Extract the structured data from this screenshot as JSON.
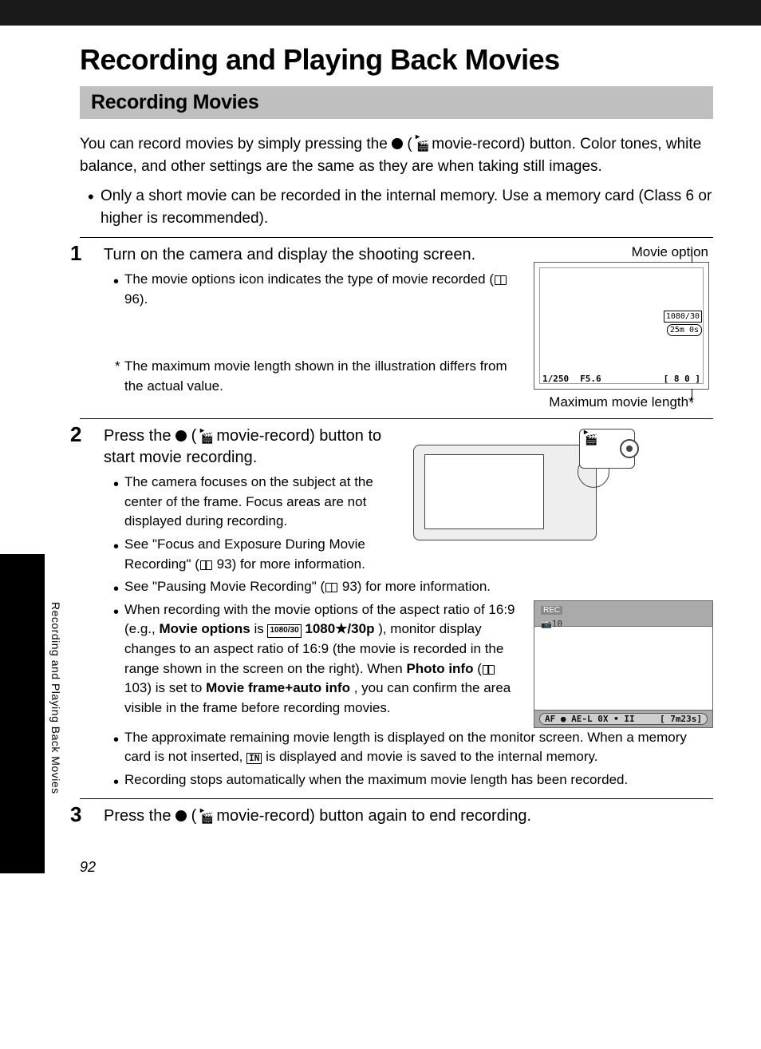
{
  "sideCaption": "Recording and Playing Back Movies",
  "pageNumber": "92",
  "title": "Recording and Playing Back Movies",
  "sectionTitle": "Recording Movies",
  "intro": {
    "p1_a": "You can record movies by simply pressing the ",
    "p1_b": " ( ",
    "p1_c": " movie-record) button. Color tones, white balance, and other settings are the same as they are when taking still images.",
    "bullet1": "Only a short movie can be recorded in the internal memory. Use a memory card (Class 6 or higher is recommended)."
  },
  "step1": {
    "head": "Turn on the camera and display the shooting screen.",
    "b1_a": "The movie options icon indicates the type of movie recorded (",
    "b1_ref": "96",
    "b1_b": ").",
    "note": "The maximum movie length shown in the illustration differs from the actual value.",
    "capTop": "Movie option",
    "capBottom": "Maximum movie length*",
    "fig": {
      "shutter": "1/250",
      "fnum": "F5.6",
      "count": "[  8 0 ]",
      "res": "1080/30",
      "time": "25m 0s"
    }
  },
  "step2": {
    "head_a": "Press the ",
    "head_b": " ( ",
    "head_c": " movie-record) button to start movie recording.",
    "b1": "The camera focuses on the subject at the center of the frame. Focus areas are not displayed during recording.",
    "b2_a": "See \"Focus and Exposure During Movie Recording\" (",
    "b2_ref": "93",
    "b2_b": ") for more information.",
    "b3_a": "See \"Pausing Movie Recording\" (",
    "b3_ref": "93",
    "b3_b": ") for more information.",
    "b4_a": "When recording with the movie options of the aspect ratio of 16:9 (e.g., ",
    "b4_mo": "Movie options",
    "b4_b": " is ",
    "b4_opt": "1080★/30p",
    "b4_c": "), monitor display changes to an aspect ratio of 16:9 (the movie is recorded in the range shown in the screen on the right). When ",
    "b4_pi": "Photo info",
    "b4_d": " (",
    "b4_ref": "103",
    "b4_e": ") is set to ",
    "b4_mf": "Movie frame+auto info",
    "b4_f": ", you can confirm the area visible in the frame before recording movies.",
    "b5_a": "The approximate remaining movie length is displayed on the monitor screen. When a memory card is not inserted, ",
    "b5_b": " is displayed and movie is saved to the internal memory.",
    "b6": "Recording stops automatically when the maximum movie length has been recorded.",
    "rec": {
      "label": "REC",
      "sub": "10",
      "left": "AF ● AE-L  0X • II",
      "right": "[  7m23s]"
    }
  },
  "step3": {
    "head_a": "Press the ",
    "head_b": " ( ",
    "head_c": " movie-record) button again to end recording."
  }
}
